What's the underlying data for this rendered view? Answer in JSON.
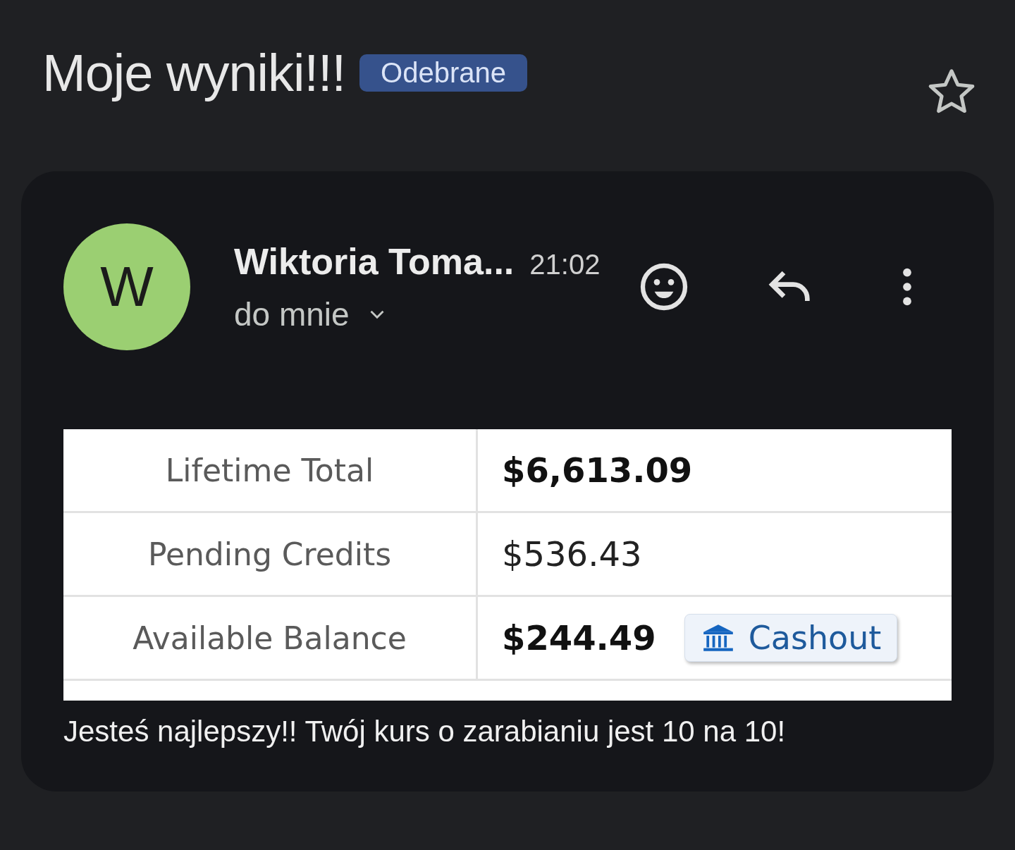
{
  "subject": "Moje wyniki!!!",
  "label": "Odebrane",
  "starred": false,
  "message": {
    "sender_initial": "W",
    "sender": "Wiktoria Toma...",
    "time": "21:02",
    "recipient": "do mnie"
  },
  "table": {
    "rows": [
      {
        "label": "Lifetime Total",
        "value": "$6,613.09",
        "bold": true
      },
      {
        "label": "Pending Credits",
        "value": "$536.43",
        "bold": false
      },
      {
        "label": "Available Balance",
        "value": "$244.49",
        "bold": true,
        "action": "Cashout"
      }
    ]
  },
  "body": "Jesteś najlepszy!! Twój kurs o zarabianiu jest 10 na 10!"
}
